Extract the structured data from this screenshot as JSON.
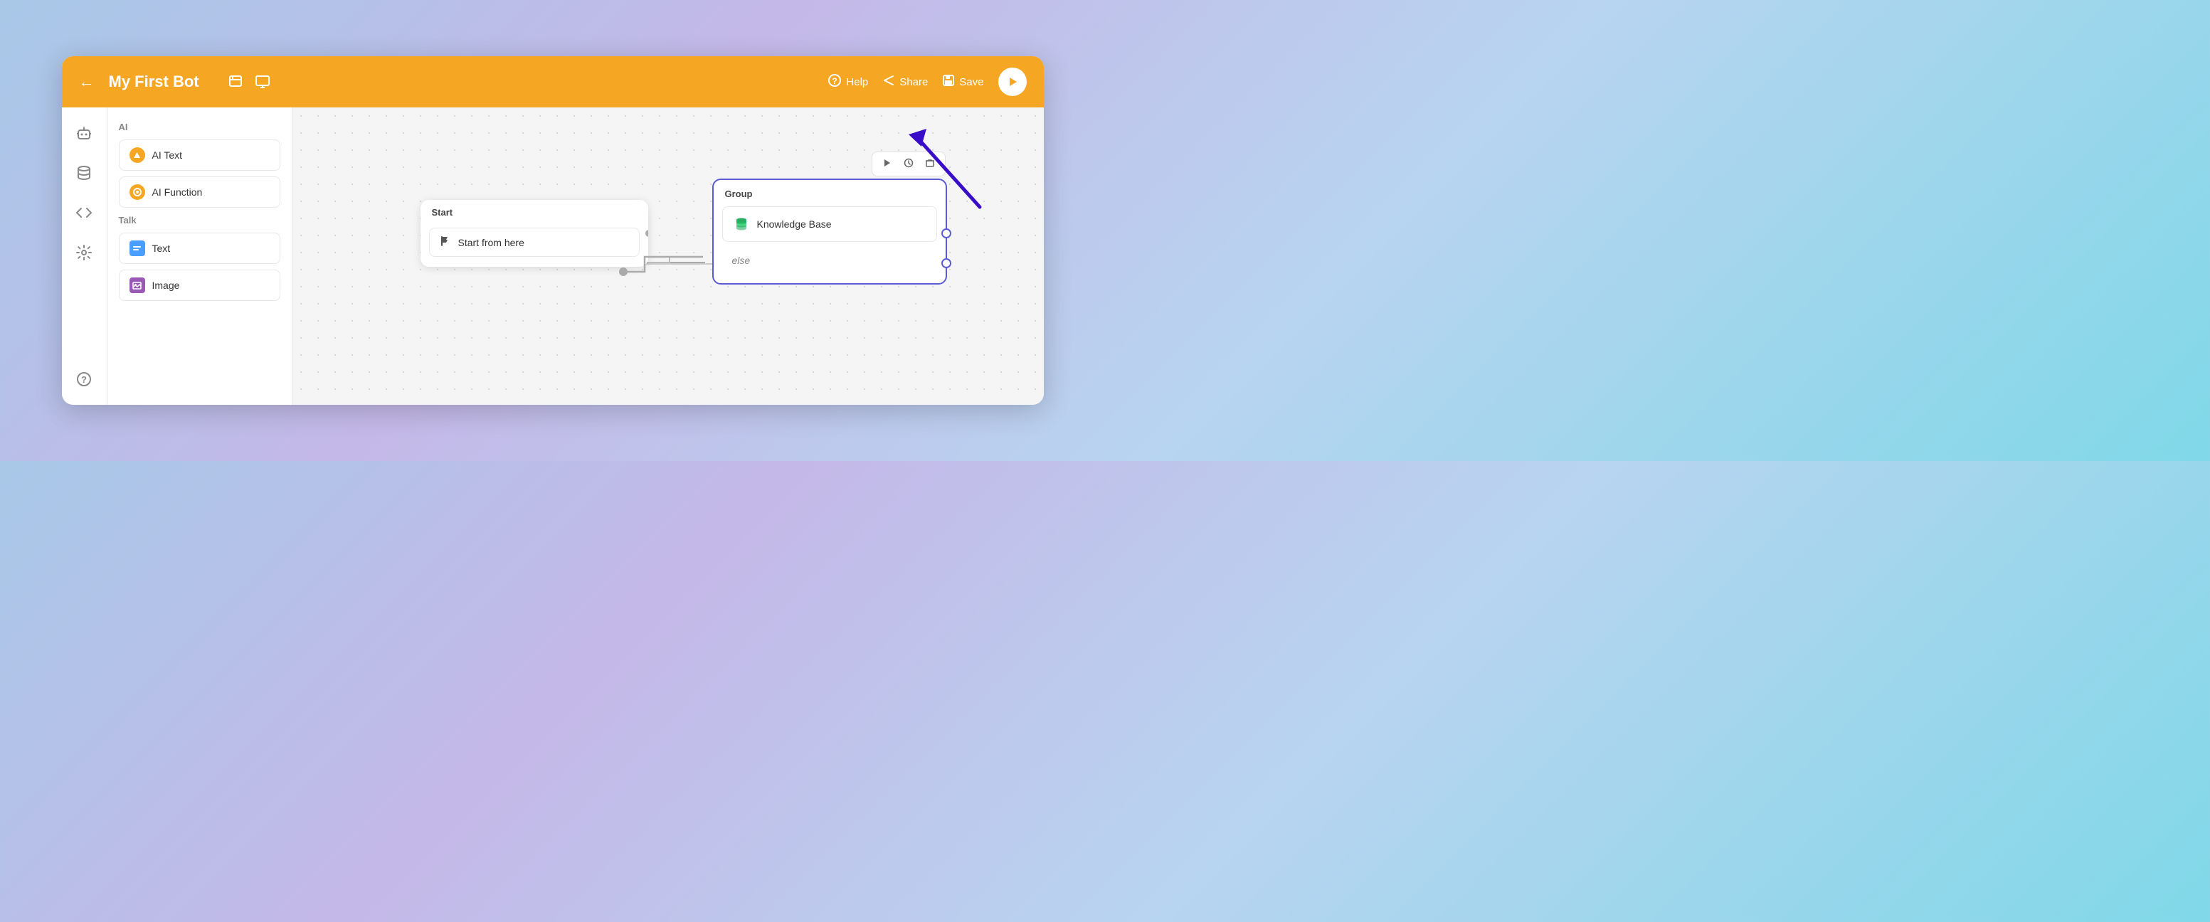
{
  "header": {
    "title": "My First Bot",
    "back_label": "←",
    "help_label": "Help",
    "share_label": "Share",
    "save_label": "Save",
    "icon1": "✎",
    "icon2": "⊞"
  },
  "sidebar": {
    "items": [
      {
        "name": "bot-icon",
        "icon": "🤖"
      },
      {
        "name": "database-icon",
        "icon": "🗄"
      },
      {
        "name": "code-icon",
        "icon": "</>"
      },
      {
        "name": "settings-icon",
        "icon": "⚙"
      }
    ],
    "bottom": {
      "name": "help-icon",
      "icon": "?"
    }
  },
  "left_panel": {
    "sections": [
      {
        "title": "AI",
        "items": [
          {
            "label": "AI Text",
            "icon": "ai"
          },
          {
            "label": "AI Function",
            "icon": "ai"
          }
        ]
      },
      {
        "title": "Talk",
        "items": [
          {
            "label": "Text",
            "icon": "text"
          },
          {
            "label": "Image",
            "icon": "image"
          }
        ]
      }
    ]
  },
  "canvas": {
    "start_node": {
      "header": "Start",
      "item": {
        "icon": "flag",
        "label": "Start from here"
      }
    },
    "group_node": {
      "header": "Group",
      "items": [
        {
          "icon": "kb",
          "label": "Knowledge Base"
        },
        {
          "label": "else"
        }
      ],
      "toolbar": {
        "play": "▶",
        "clock": "⏱",
        "trash": "🗑"
      }
    }
  }
}
